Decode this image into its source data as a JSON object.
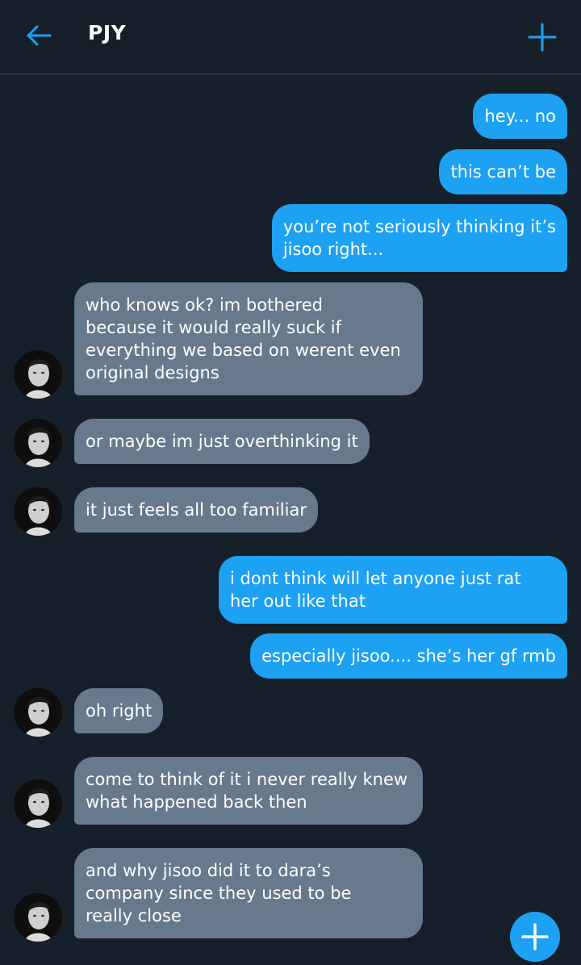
{
  "header": {
    "title": "PJY",
    "back_icon": "arrow-left-icon",
    "add_icon": "plus-icon"
  },
  "colors": {
    "background": "#15202b",
    "sent_bubble": "#1da1f2",
    "received_bubble": "#67798a",
    "accent": "#1da1f2"
  },
  "messages": [
    {
      "from": "me",
      "text": "hey... no"
    },
    {
      "from": "me",
      "text": "this can’t be"
    },
    {
      "from": "me",
      "text": "you’re not seriously thinking it’s\njisoo right..."
    },
    {
      "from": "PJY",
      "text": "who knows ok? im bothered\nbecause it would really suck if\neverything we based on werent even\noriginal designs"
    },
    {
      "from": "PJY",
      "text": "or maybe im just overthinking it"
    },
    {
      "from": "PJY",
      "text": "it just feels all too familiar"
    },
    {
      "from": "me",
      "text": "i dont think will let anyone just rat\nher out like that"
    },
    {
      "from": "me",
      "text": "especially jisoo.... she’s her gf rmb"
    },
    {
      "from": "PJY",
      "text": "oh right"
    },
    {
      "from": "PJY",
      "text": "come to think of it i never really knew\nwhat happened back then"
    },
    {
      "from": "PJY",
      "text": "and why jisoo did it to dara’s\ncompany since they used to be\nreally close"
    }
  ],
  "fab_icon": "plus-icon"
}
